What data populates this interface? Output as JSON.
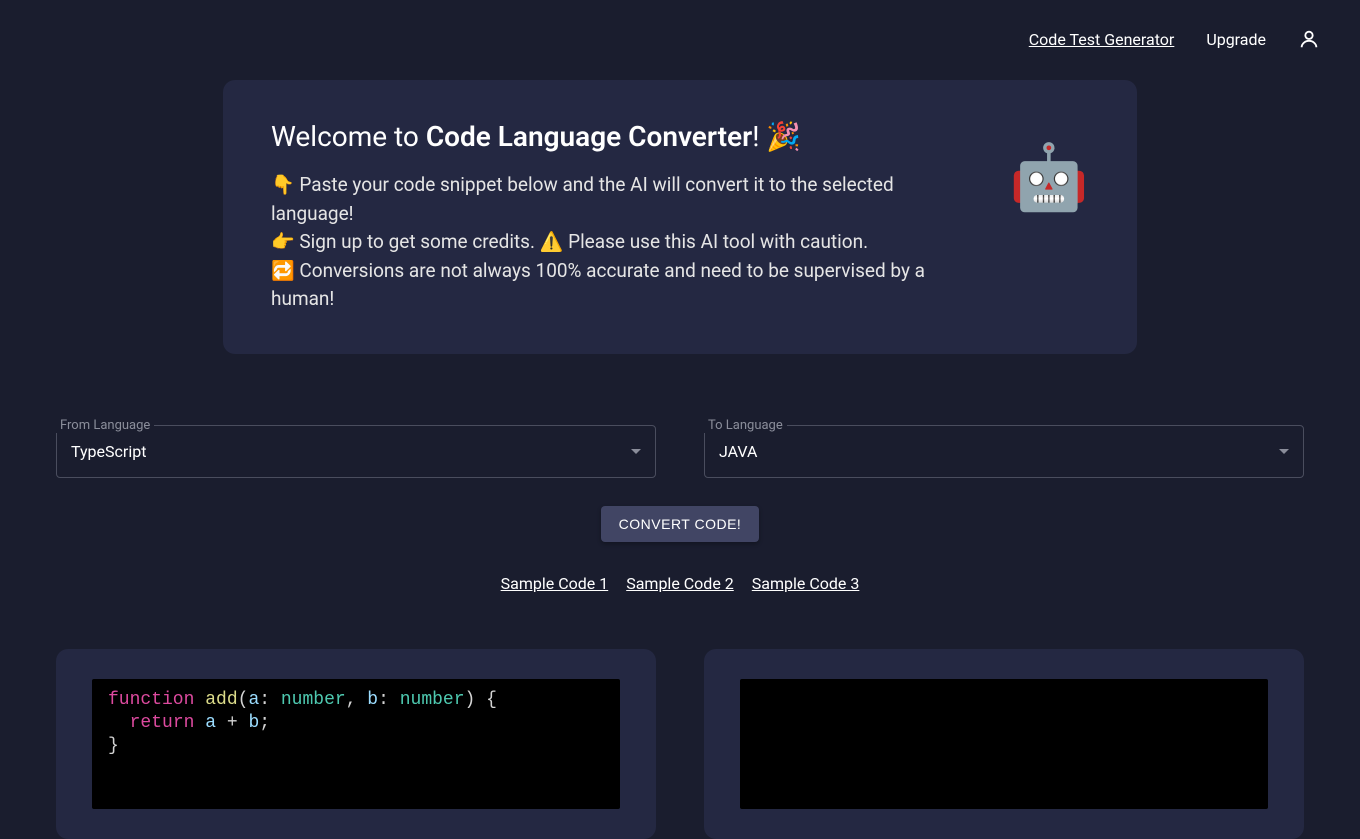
{
  "header": {
    "link1": "Code Test Generator",
    "link2": "Upgrade"
  },
  "welcome": {
    "prefix": "Welcome to ",
    "bold": "Code Language Converter",
    "suffix": "! 🎉",
    "line1": "👇 Paste your code snippet below and the AI will convert it to the selected language!",
    "line2a": "👉 Sign up to get some credits. ⚠️ Please use this AI tool with caution.",
    "line3": "🔁 Conversions are not always 100% accurate and need to be supervised by a human!",
    "robot": "🤖"
  },
  "from": {
    "label": "From Language",
    "value": "TypeScript"
  },
  "to": {
    "label": "To Language",
    "value": "JAVA"
  },
  "convert_label": "CONVERT CODE!",
  "samples": {
    "s1": "Sample Code 1",
    "s2": "Sample Code 2",
    "s3": "Sample Code 3"
  },
  "code": {
    "kw_function": "function",
    "fn_name": "add",
    "paren_open": "(",
    "param_a": "a",
    "colon1": ": ",
    "type1": "number",
    "comma": ", ",
    "param_b": "b",
    "colon2": ": ",
    "type2": "number",
    "paren_close": ")",
    "brace_open": " {",
    "indent": "  ",
    "kw_return": "return",
    "ret_a": " a ",
    "plus": "+",
    "ret_b": " b",
    "semi": ";",
    "brace_close": "}"
  }
}
